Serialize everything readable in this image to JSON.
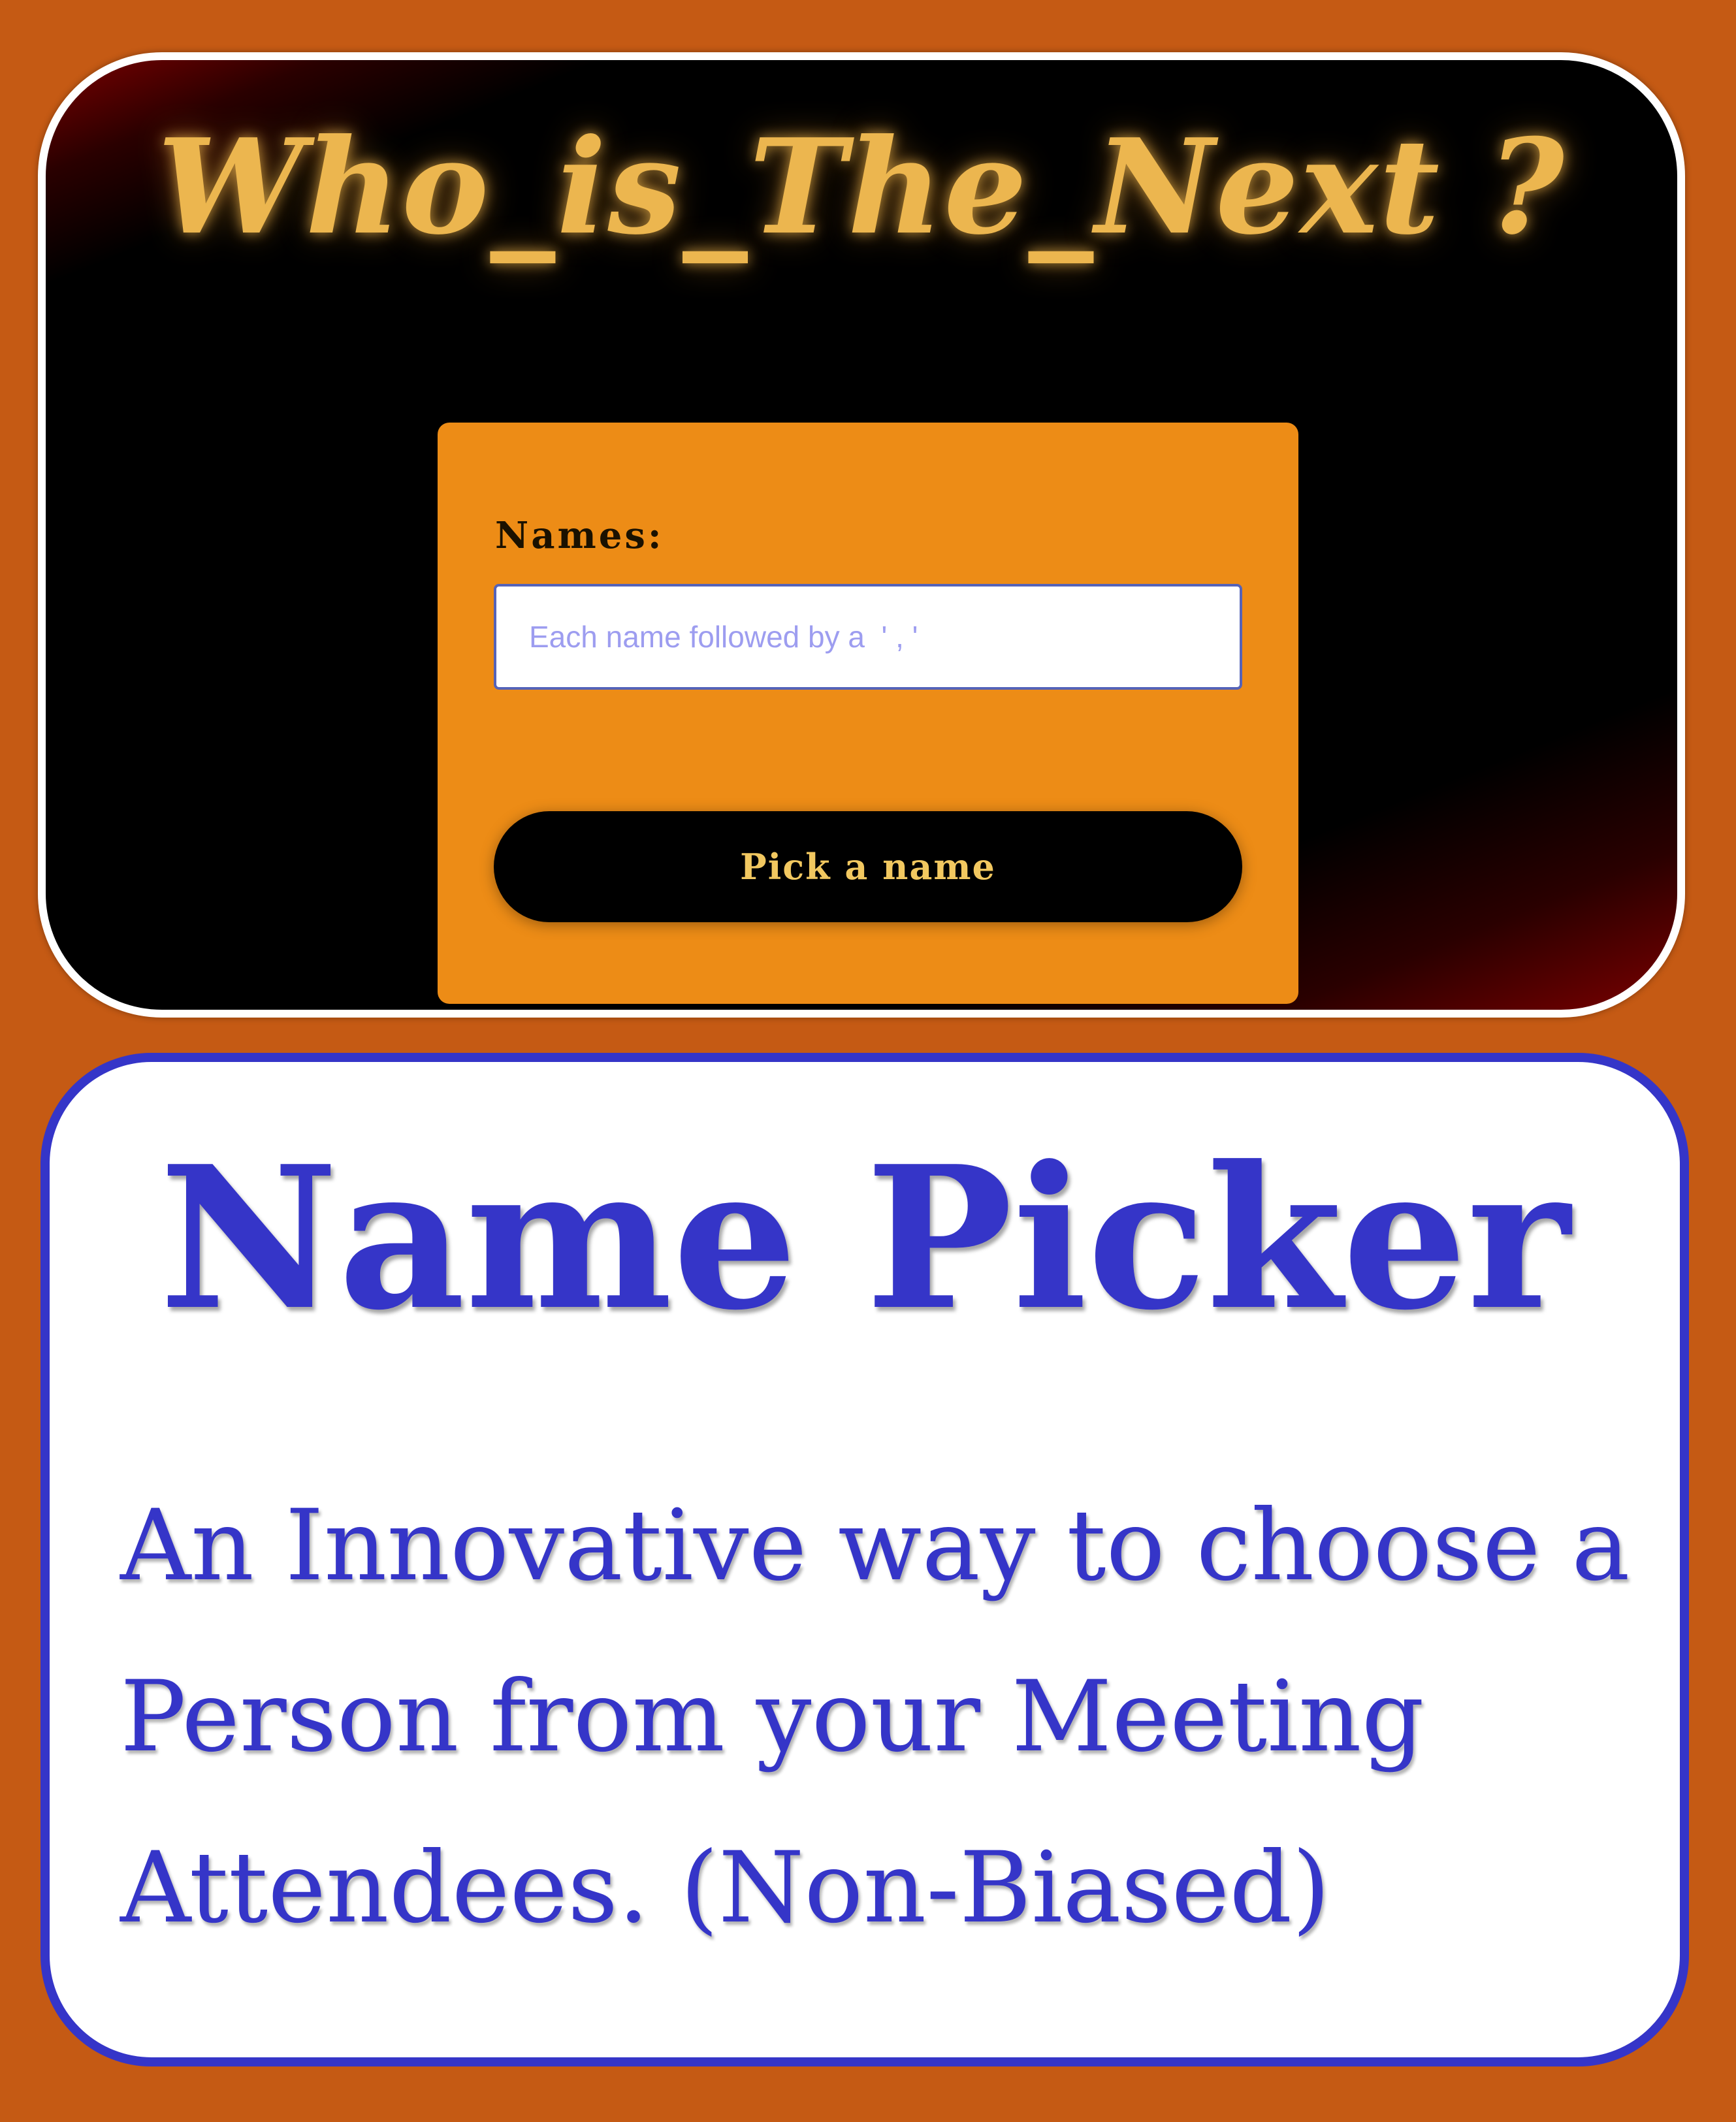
{
  "app": {
    "title": "Who_is_The_Next ?",
    "form": {
      "names_label": "Names:",
      "names_input_value": "",
      "names_input_placeholder": "Each name followed by a  ' , '",
      "pick_button_label": "Pick a name"
    }
  },
  "info": {
    "title": "Name Picker",
    "description": "An Innovative way to choose a Person from your Meeting Attendees. (Non-Biased)"
  },
  "colors": {
    "background": "#c55a14",
    "form_panel": "#ed8c16",
    "title_gold": "#ecb64f",
    "accent_blue": "#3535c8"
  }
}
